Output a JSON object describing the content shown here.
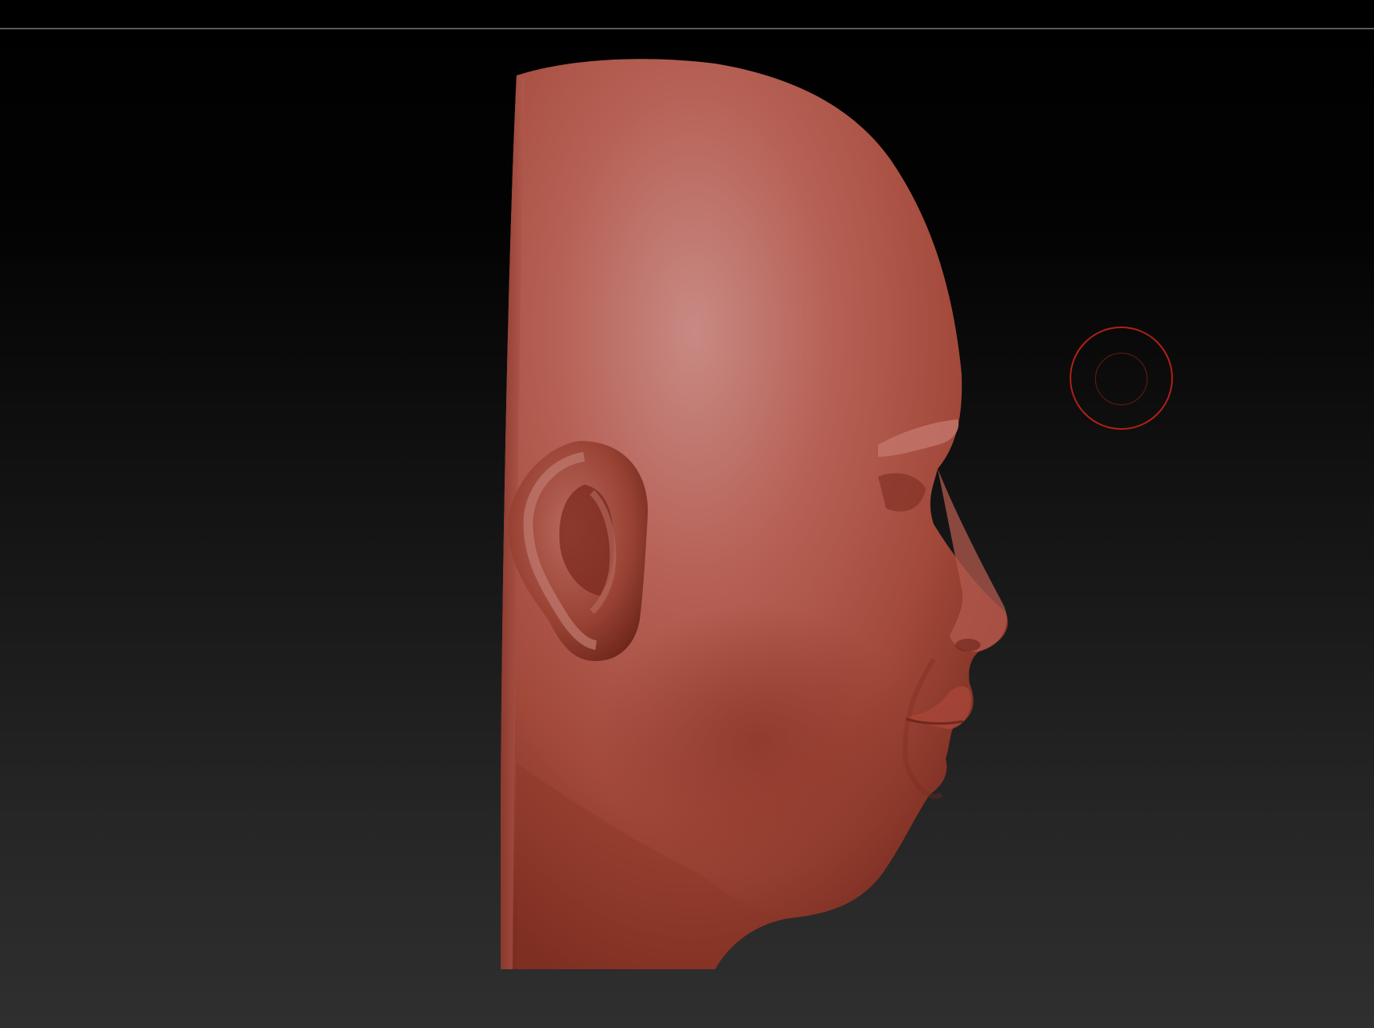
{
  "viewport": {
    "background_top": "#000000",
    "background_bottom": "#2f2f2f",
    "top_rule_color": "#5a5a5a"
  },
  "model": {
    "material_color": "#a84a3a",
    "highlight_color": "#c98a84",
    "shadow_color": "#6e2418",
    "view": "right-profile"
  },
  "brush_cursor": {
    "outer_color": "#b22016",
    "inner_color": "#6a1a12"
  }
}
